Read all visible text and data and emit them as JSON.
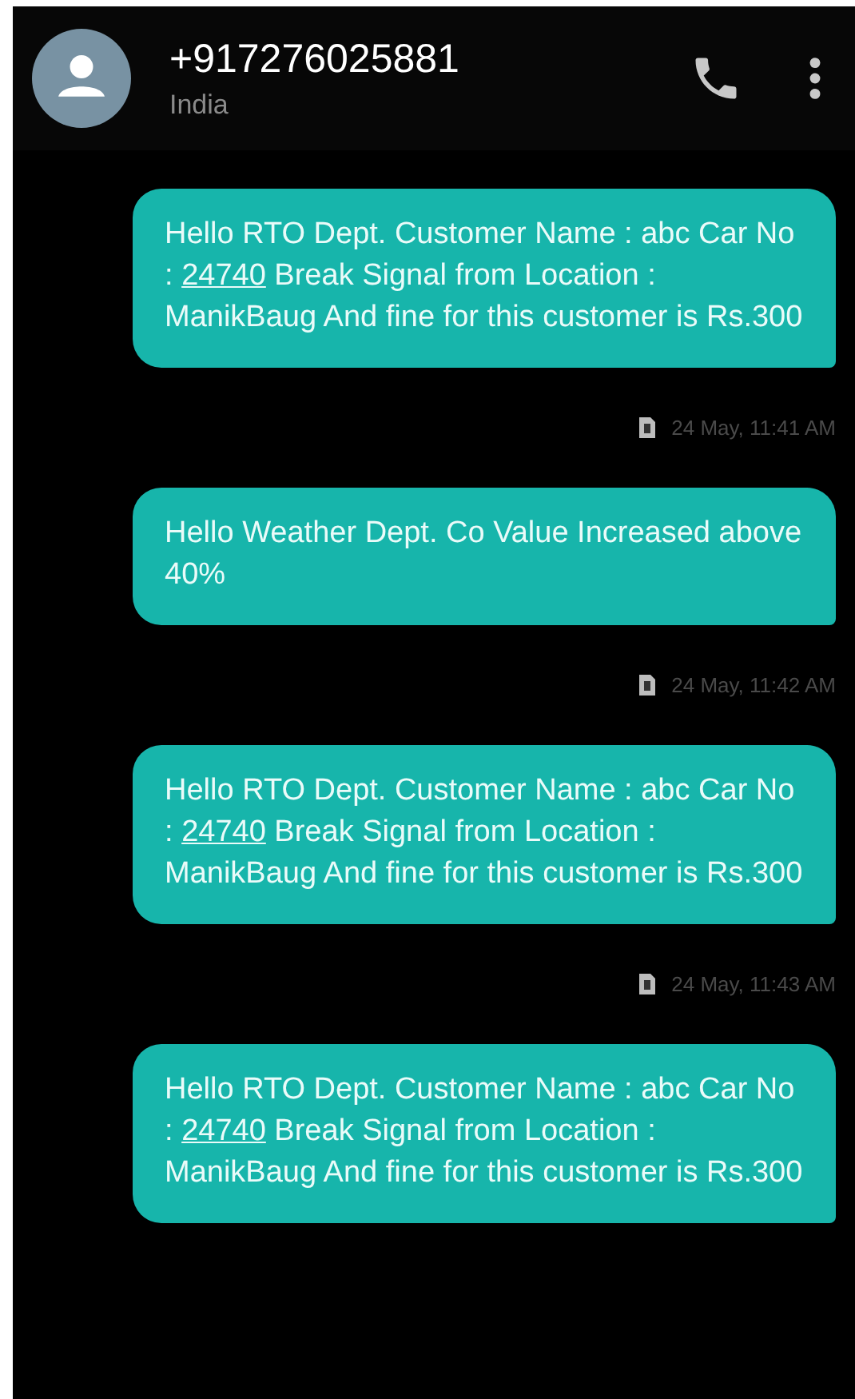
{
  "header": {
    "title": "+917276025881",
    "subtitle": "India"
  },
  "messages": [
    {
      "kind": "message",
      "parts": [
        {
          "kind": "text",
          "text": "Hello RTO Dept. Customer Name : abc Car No : "
        },
        {
          "kind": "link",
          "text": "24740"
        },
        {
          "kind": "text",
          "text": " Break Signal from Location : ManikBaug And  fine for this customer is Rs.300"
        }
      ]
    },
    {
      "kind": "timestamp",
      "text": "24 May, 11:41 AM"
    },
    {
      "kind": "message",
      "parts": [
        {
          "kind": "text",
          "text": "Hello Weather  Dept. Co Value Increased above 40%"
        }
      ]
    },
    {
      "kind": "timestamp",
      "text": "24 May, 11:42 AM"
    },
    {
      "kind": "message",
      "parts": [
        {
          "kind": "text",
          "text": "Hello RTO Dept. Customer Name : abc Car No : "
        },
        {
          "kind": "link",
          "text": "24740"
        },
        {
          "kind": "text",
          "text": " Break Signal from Location : ManikBaug And  fine for this customer is Rs.300"
        }
      ]
    },
    {
      "kind": "timestamp",
      "text": "24 May, 11:43 AM"
    },
    {
      "kind": "message",
      "parts": [
        {
          "kind": "text",
          "text": "Hello RTO Dept. Customer Name : abc Car No : "
        },
        {
          "kind": "link",
          "text": "24740"
        },
        {
          "kind": "text",
          "text": " Break Signal from Location : ManikBaug And  fine for this customer is Rs.300"
        }
      ]
    }
  ]
}
